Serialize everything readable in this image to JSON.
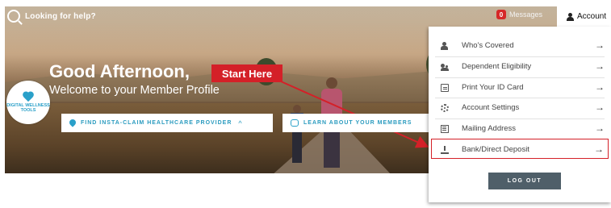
{
  "topbar": {
    "help_text": "Looking for help?",
    "messages_badge": "0",
    "messages_label": "Messages",
    "account_label": "Account"
  },
  "hero": {
    "greeting": "Good Afternoon,",
    "welcome": "Welcome to your Member Profile",
    "callout": "Start Here",
    "wellness_badge": "DIGITAL WELLNESS TOOLS",
    "find_provider_label": "FIND INSTA-CLAIM HEALTHCARE PROVIDER",
    "learn_members_label": "LEARN ABOUT YOUR MEMBERS"
  },
  "account_menu": {
    "items": [
      {
        "label": "Who's Covered",
        "icon": "person-icon",
        "arrow": "→"
      },
      {
        "label": "Dependent Eligibility",
        "icon": "people-icon",
        "arrow": "→"
      },
      {
        "label": "Print Your ID Card",
        "icon": "id-card-icon",
        "arrow": "→"
      },
      {
        "label": "Account Settings",
        "icon": "gear-icon",
        "arrow": "→"
      },
      {
        "label": "Mailing Address",
        "icon": "mail-icon",
        "arrow": "→"
      },
      {
        "label": "Bank/Direct Deposit",
        "icon": "download-icon",
        "arrow": "→",
        "highlighted": true
      }
    ],
    "logout_label": "LOG OUT"
  },
  "colors": {
    "accent_red": "#d42028",
    "brand_teal": "#2aa0c9",
    "logout_bg": "#4f5f69"
  }
}
